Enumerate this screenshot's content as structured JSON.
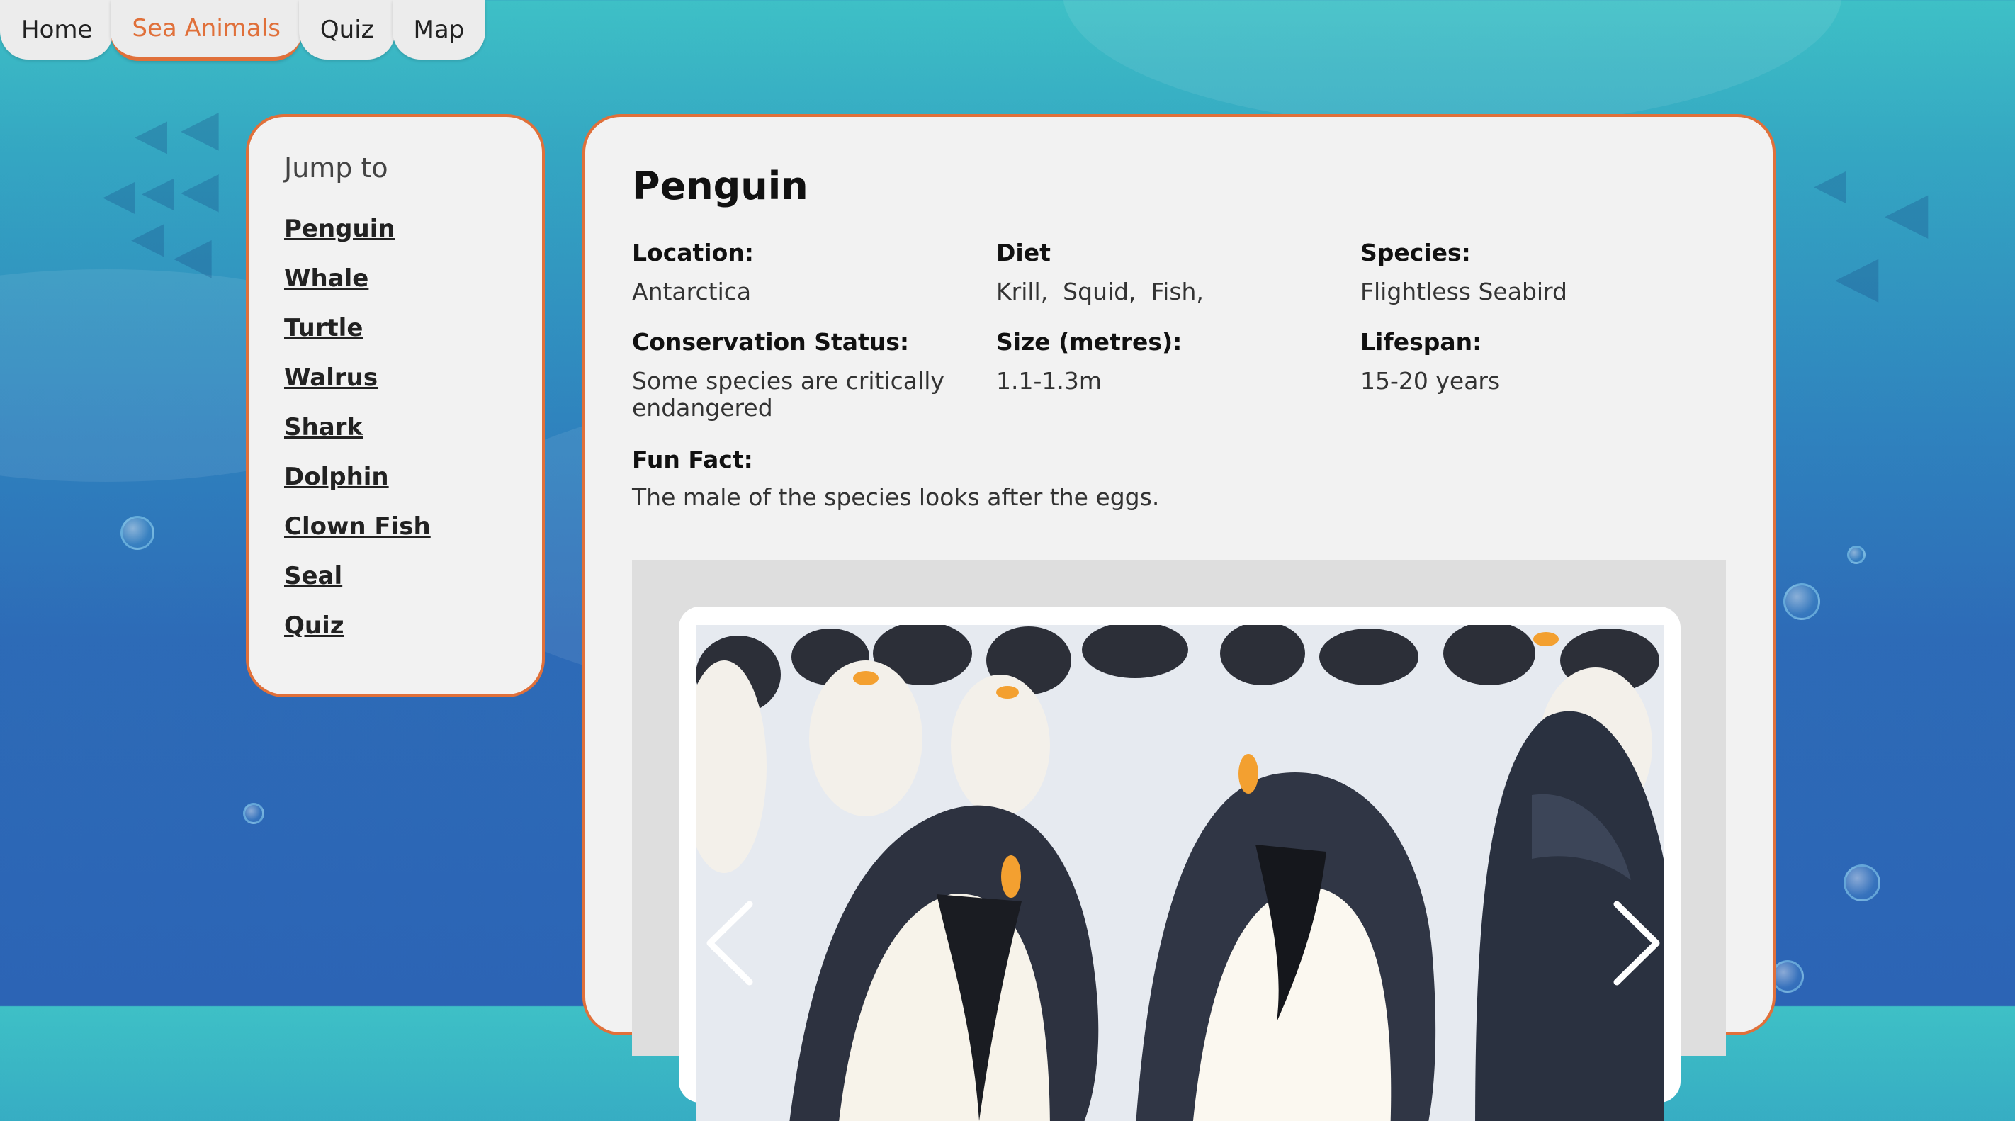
{
  "nav": {
    "tabs": [
      {
        "label": "Home"
      },
      {
        "label": "Sea Animals"
      },
      {
        "label": "Quiz"
      },
      {
        "label": "Map"
      }
    ],
    "active_index": 1
  },
  "sidebar": {
    "title": "Jump to",
    "links": [
      "Penguin",
      "Whale",
      "Turtle",
      "Walrus",
      "Shark",
      "Dolphin",
      "Clown Fish",
      "Seal",
      "Quiz"
    ]
  },
  "animal": {
    "name": "Penguin",
    "location_label": "Location:",
    "location": "Antarctica",
    "diet_label": "Diet",
    "diet": "Krill,  Squid,  Fish,",
    "species_label": "Species:",
    "species": "Flightless Seabird",
    "conservation_label": "Conservation Status:",
    "conservation_line1": "Some species are critically",
    "conservation_line2": "endangered",
    "size_label": "Size (metres):",
    "size": "1.1-1.3m",
    "lifespan_label": "Lifespan:",
    "lifespan": "15-20 years",
    "funfact_label": "Fun Fact:",
    "funfact": "The male of the species looks after the eggs."
  },
  "gallery": {
    "image_subject": "emperor penguins",
    "prev_icon": "chevron-left-icon",
    "next_icon": "chevron-right-icon"
  },
  "colors": {
    "accent": "#e0703a",
    "panel": "#f2f2f2",
    "ocean_top": "#3ec0c6",
    "ocean_bottom": "#2c64b5"
  }
}
